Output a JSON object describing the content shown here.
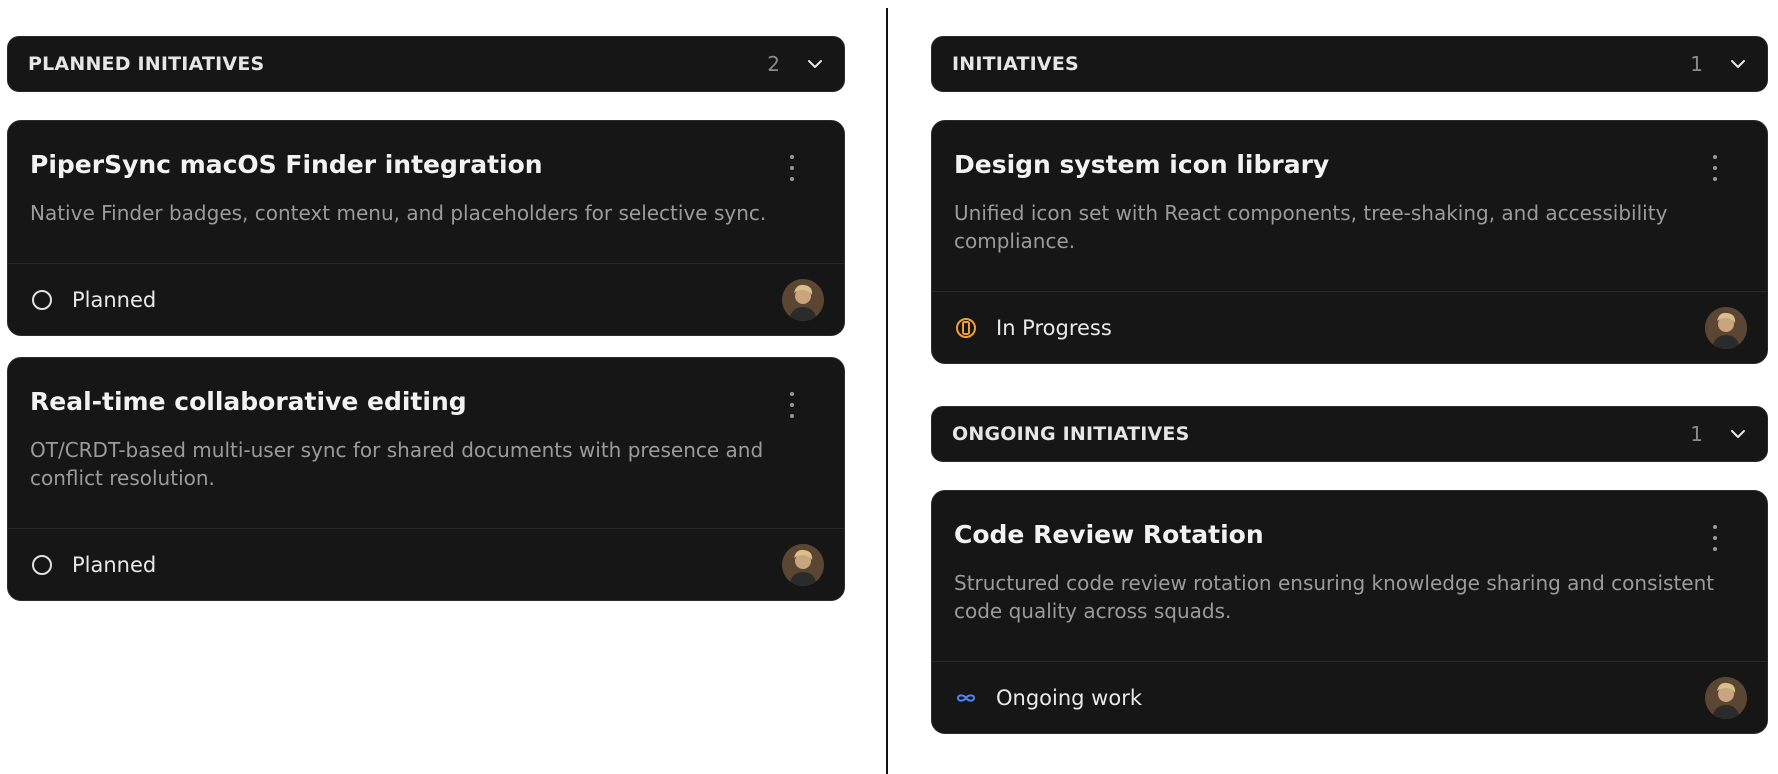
{
  "colors": {
    "card_bg": "#161616",
    "in_progress": "#f0a030",
    "ongoing": "#4f86f7",
    "planned": "#e0e0e0"
  },
  "left": {
    "header": {
      "title": "PLANNED INITIATIVES",
      "count": "2"
    },
    "cards": [
      {
        "title": "PiperSync macOS Finder integration",
        "description": "Native Finder badges, context menu, and placeholders for selective sync.",
        "status": "Planned",
        "status_icon": "circle-outline-icon"
      },
      {
        "title": "Real-time collaborative editing",
        "description": "OT/CRDT-based multi-user sync for shared documents with presence and conflict resolution.",
        "status": "Planned",
        "status_icon": "circle-outline-icon"
      }
    ]
  },
  "right": {
    "sections": [
      {
        "header": {
          "title": "INITIATIVES",
          "count": "1"
        },
        "cards": [
          {
            "title": "Design system icon library",
            "description": "Unified icon set with React components, tree-shaking, and accessibility compliance.",
            "status": "In Progress",
            "status_icon": "half-circle-progress-icon"
          }
        ]
      },
      {
        "header": {
          "title": "ONGOING INITIATIVES",
          "count": "1"
        },
        "cards": [
          {
            "title": "Code Review Rotation",
            "description": "Structured code review rotation ensuring knowledge sharing and consistent code quality across squads.",
            "status": "Ongoing work",
            "status_icon": "infinity-icon"
          }
        ]
      }
    ]
  }
}
